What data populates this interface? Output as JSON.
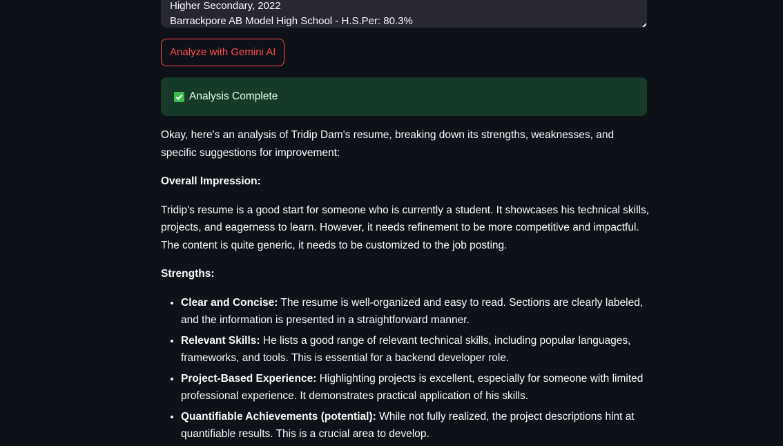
{
  "education_textarea": {
    "line1": "Higher Secondary, 2022",
    "line2": "Barrackpore AB Model High School - H.S.Per: 80.3%"
  },
  "analyze_button": {
    "label": "Analyze with Gemini AI"
  },
  "status_alert": {
    "icon": "check-icon",
    "text": "Analysis Complete",
    "color": "#173928"
  },
  "analysis": {
    "intro": "Okay, here's an analysis of Tridip Dam's resume, breaking down its strengths, weaknesses, and specific suggestions for improvement:",
    "overall_heading": "Overall Impression:",
    "overall_text": "Tridip's resume is a good start for someone who is currently a student. It showcases his technical skills, projects, and eagerness to learn. However, it needs refinement to be more competitive and impactful. The content is quite generic, it needs to be customized to the job posting.",
    "strengths_heading": "Strengths:",
    "strengths": [
      {
        "title": "Clear and Concise:",
        "text": " The resume is well-organized and easy to read. Sections are clearly labeled, and the information is presented in a straightforward manner."
      },
      {
        "title": "Relevant Skills:",
        "text": " He lists a good range of relevant technical skills, including popular languages, frameworks, and tools. This is essential for a backend developer role."
      },
      {
        "title": "Project-Based Experience:",
        "text": " Highlighting projects is excellent, especially for someone with limited professional experience. It demonstrates practical application of his skills."
      },
      {
        "title": "Quantifiable Achievements (potential):",
        "text": " While not fully realized, the project descriptions hint at quantifiable results. This is a crucial area to develop."
      }
    ]
  },
  "colors": {
    "background": "#0e1117",
    "accent": "#ff4b4b",
    "input_bg": "#262730",
    "success_bg": "#173928"
  }
}
